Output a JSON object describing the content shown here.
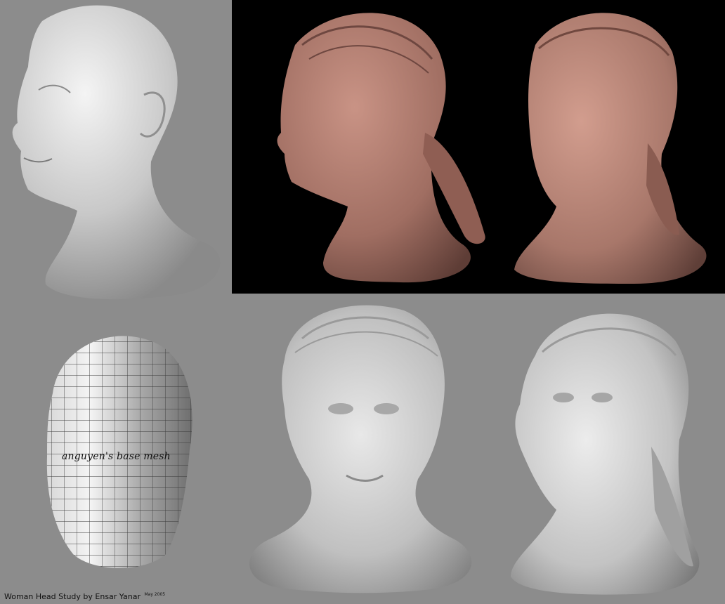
{
  "mesh_label": "anguyen's base mesh",
  "caption": {
    "title": "Woman Head Study",
    "author": "by Ensar Yanar",
    "date": "May 2005"
  },
  "colors": {
    "background": "#8c8c8c",
    "render_backdrop": "#000000",
    "clay_skin": "#b07a6c",
    "gray_sculpt": "#d4d4d4"
  }
}
